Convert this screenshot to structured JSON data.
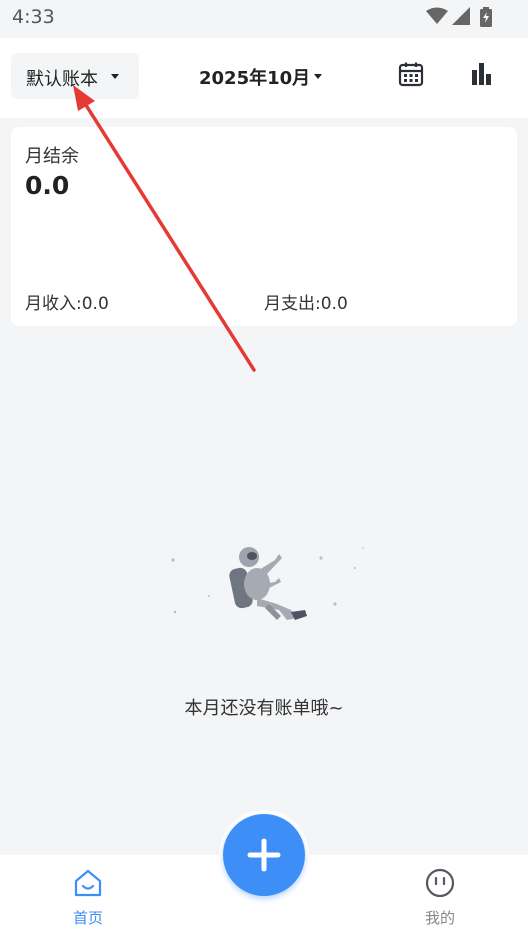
{
  "status_bar": {
    "time": "4:33",
    "icons": [
      "wifi-icon",
      "signal-icon",
      "battery-charging-icon"
    ]
  },
  "header": {
    "book_selector_label": "默认账本",
    "month_label": "2025年10月",
    "icons": [
      "calendar-icon",
      "bar-chart-icon"
    ]
  },
  "summary": {
    "balance_label": "月结余",
    "balance_value": "0.0",
    "income_text": "月收入:0.0",
    "expense_text": "月支出:0.0"
  },
  "empty_state": {
    "message": "本月还没有账单哦~",
    "illustration": "astronaut-floating-illustration"
  },
  "fab": {
    "icon": "plus-icon"
  },
  "bottom_nav": {
    "items": [
      {
        "label": "首页",
        "icon": "home-icon",
        "active": true
      },
      {
        "label": "我的",
        "icon": "profile-face-icon",
        "active": false
      }
    ]
  },
  "annotation": {
    "type": "red-arrow",
    "color": "#e53935"
  },
  "colors": {
    "accent": "#3d8ef7",
    "background": "#f4f5f7",
    "card": "#ffffff",
    "inactive": "#888888"
  }
}
